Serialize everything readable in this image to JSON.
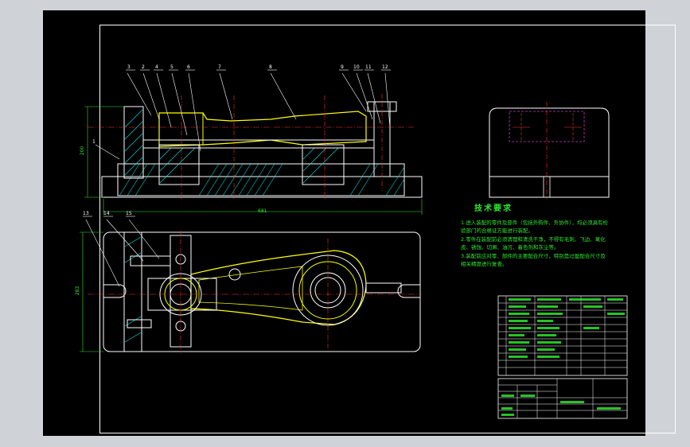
{
  "drawing": {
    "tech_req_title": "技术要求",
    "tech_req_items": [
      "1.进入装配的零件及部件（包括外购件、外协件），均必须具有检验部门的合格证方能进行装配。",
      "2.零件在装配前必须清理和清洗干净，不得有毛刺、飞边、氧化皮、锈蚀、切屑、油污、着色剂和灰尘等。",
      "3.装配前应对零、部件的主要配合尺寸，特别是过盈配合尺寸及相关精度进行复查。"
    ],
    "dimensions": {
      "front_width": "681",
      "front_height": "200",
      "top_height": "283"
    },
    "balloons_front": [
      "3",
      "2",
      "4",
      "5",
      "6",
      "7",
      "8",
      "9",
      "10",
      "11",
      "12",
      "1"
    ],
    "balloons_top": [
      "13",
      "14",
      "15"
    ]
  },
  "colors": {
    "background": "#000000",
    "frame": "#ffffff",
    "outline": "#ffffff",
    "part": "#ffff00",
    "hatch": "#00e5e5",
    "centerline": "#ff3030",
    "hidden": "#cc33cc",
    "text": "#2ee62e"
  }
}
